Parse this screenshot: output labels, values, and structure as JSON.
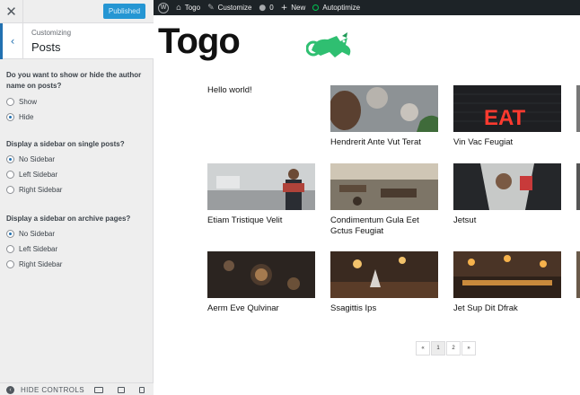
{
  "panel": {
    "publish_label": "Published",
    "breadcrumb": "Customizing",
    "section_title": "Posts",
    "groups": [
      {
        "question": "Do you want to show or hide the author name on posts?",
        "options": [
          {
            "label": "Show",
            "checked": false
          },
          {
            "label": "Hide",
            "checked": true
          }
        ]
      },
      {
        "question": "Display a sidebar on single posts?",
        "options": [
          {
            "label": "No Sidebar",
            "checked": true
          },
          {
            "label": "Left Sidebar",
            "checked": false
          },
          {
            "label": "Right Sidebar",
            "checked": false
          }
        ]
      },
      {
        "question": "Display a sidebar on archive pages?",
        "options": [
          {
            "label": "No Sidebar",
            "checked": true
          },
          {
            "label": "Left Sidebar",
            "checked": false
          },
          {
            "label": "Right Sidebar",
            "checked": false
          }
        ]
      }
    ],
    "hide_controls_label": "HIDE CONTROLS"
  },
  "adminbar": {
    "site": "Togo",
    "customize": "Customize",
    "comments": "0",
    "new": "New",
    "autoptimize": "Autoptimize"
  },
  "preview": {
    "logo": "Togo",
    "posts": [
      {
        "title": "Hello world!",
        "thumb": null
      },
      {
        "title": "Hendrerit Ante Vut Terat",
        "thumb": "food"
      },
      {
        "title": "Vin Vac Feugiat",
        "thumb": "neon"
      },
      {
        "title": "Etiam Tristique Velit",
        "thumb": "kitchen"
      },
      {
        "title": "Condimentum Gula Eet Gctus Feugiat",
        "thumb": "restaurant"
      },
      {
        "title": "Jetsut",
        "thumb": "car"
      },
      {
        "title": "Aerm Eve Qulvinar",
        "thumb": "plates"
      },
      {
        "title": "Ssagittis Ips",
        "thumb": "bar"
      },
      {
        "title": "Jet Sup Dit Dfrak",
        "thumb": "market"
      }
    ],
    "pagination": [
      "«",
      "1",
      "2",
      "»"
    ]
  }
}
